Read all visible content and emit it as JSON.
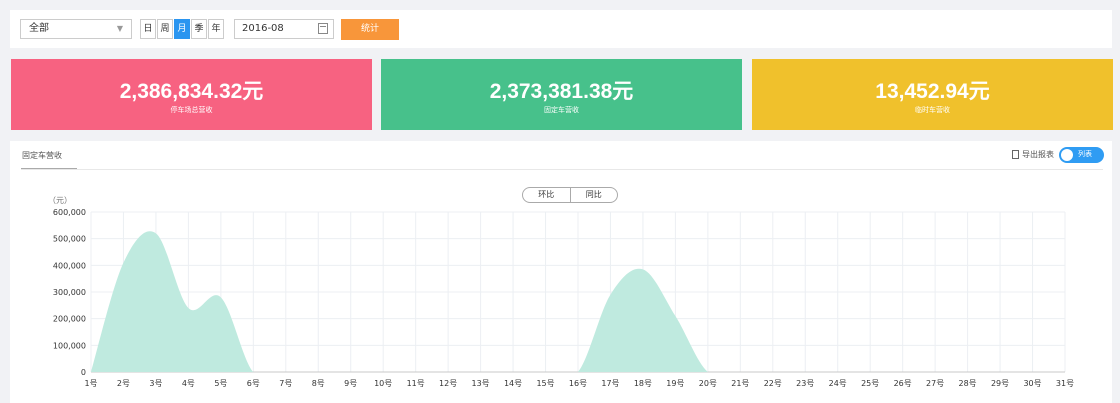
{
  "filter": {
    "select_value": "全部",
    "periods": [
      "日",
      "周",
      "月",
      "季",
      "年"
    ],
    "active_period": "月",
    "date_value": "2016-08",
    "stat_button": "统计"
  },
  "cards": [
    {
      "amount": "2,386,834.32元",
      "label": "停车场总营收",
      "color": "#f76281"
    },
    {
      "amount": "2,373,381.38元",
      "label": "固定车营收",
      "color": "#47c18b"
    },
    {
      "amount": "13,452.94元",
      "label": "临时车营收",
      "color": "#f0c12c"
    }
  ],
  "panel": {
    "tab": "固定车营收",
    "export": "导出报表",
    "toggle_label": "列表",
    "compare": [
      "环比",
      "同比"
    ]
  },
  "chart_data": {
    "type": "area",
    "ylabel": "（元）",
    "ylim": [
      0,
      600000
    ],
    "yticks": [
      "600,000",
      "500,000",
      "400,000",
      "300,000",
      "200,000",
      "100,000",
      "0"
    ],
    "categories": [
      "1号",
      "2号",
      "3号",
      "4号",
      "5号",
      "6号",
      "7号",
      "8号",
      "9号",
      "10号",
      "11号",
      "12号",
      "13号",
      "14号",
      "15号",
      "16号",
      "17号",
      "18号",
      "19号",
      "20号",
      "21号",
      "22号",
      "23号",
      "24号",
      "25号",
      "26号",
      "27号",
      "28号",
      "29号",
      "30号",
      "31号"
    ],
    "values": [
      0,
      410000,
      520000,
      240000,
      280000,
      0,
      0,
      0,
      0,
      0,
      0,
      0,
      0,
      0,
      0,
      0,
      290000,
      385000,
      210000,
      0,
      0,
      0,
      0,
      0,
      0,
      0,
      0,
      0,
      0,
      0,
      0
    ],
    "color": "#bfeadf",
    "grid": true
  }
}
